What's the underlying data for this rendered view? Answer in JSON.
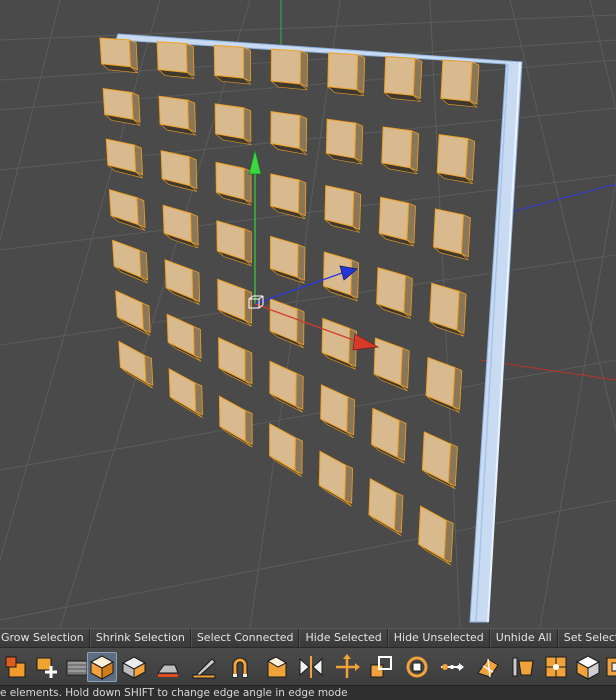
{
  "command_bar": {
    "buttons": [
      "Grow Selection",
      "Shrink Selection",
      "Select Connected",
      "Hide Selected",
      "Hide Unselected",
      "Unhide All",
      "Set Selection"
    ]
  },
  "toolbar": {
    "tools": [
      {
        "icon": "paint-select-icon"
      },
      {
        "icon": "add-point-icon"
      },
      {
        "icon": "bridge-icon"
      },
      {
        "icon": "extrude-cube-icon"
      },
      {
        "icon": "extrude-inner-icon"
      },
      {
        "icon": "iron-icon"
      },
      {
        "icon": "knife-icon"
      },
      {
        "icon": "magnet-icon"
      },
      {
        "icon": "bevel-icon"
      },
      {
        "icon": "mirror-icon"
      },
      {
        "icon": "move-axis-icon"
      },
      {
        "icon": "normal-scale-icon"
      },
      {
        "icon": "normal-rotate-icon"
      },
      {
        "icon": "slide-icon"
      },
      {
        "icon": "stitch-icon"
      },
      {
        "icon": "weld-icon"
      },
      {
        "icon": "subdivide-icon"
      },
      {
        "icon": "smooth-shift-icon"
      },
      {
        "icon": "close-hole-icon"
      }
    ]
  },
  "status": {
    "text": "e elements. Hold down SHIFT to change edge angle in edge mode"
  },
  "colors": {
    "viewport_bg": "#4a4a4a",
    "tile_face": "#d9b98e",
    "tile_edge": "#f0a020",
    "selection_blue": "#bcd2ee",
    "axis_x": "#d83a2a",
    "axis_y": "#2fc23a",
    "axis_z": "#2630d8"
  }
}
